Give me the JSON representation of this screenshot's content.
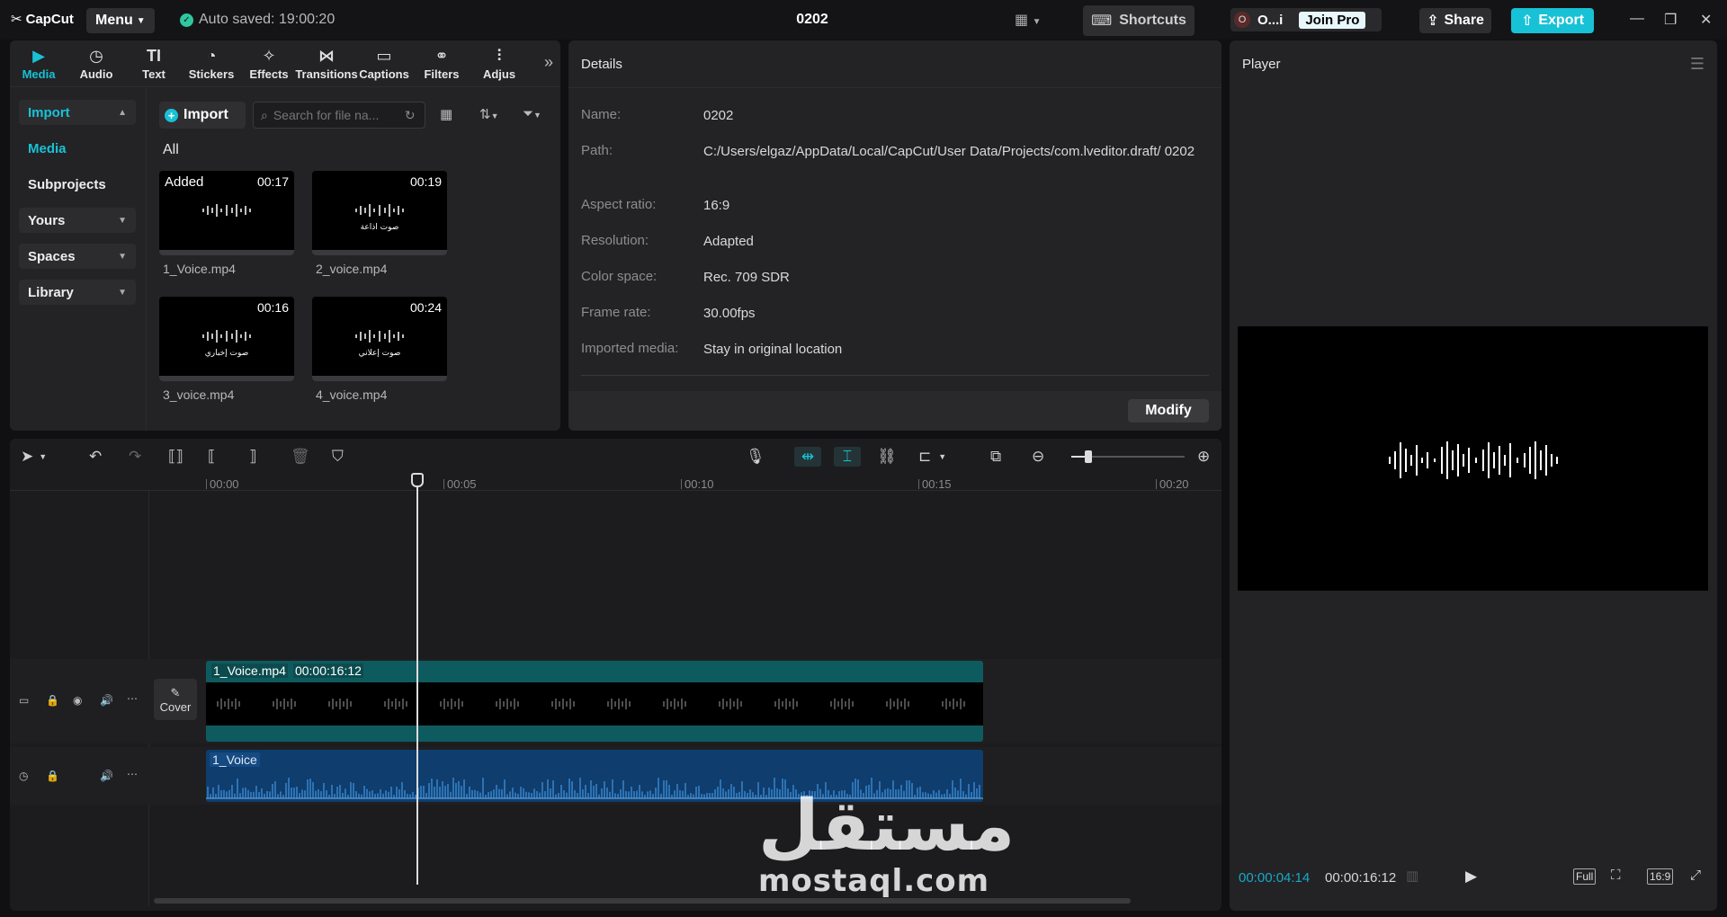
{
  "app": {
    "logo": "CapCut",
    "menu_label": "Menu",
    "autosave": "Auto saved: 19:00:20",
    "project_title": "0202",
    "shortcuts_label": "Shortcuts",
    "user_initial": "O",
    "user_name": "O...i",
    "join_pro": "Join Pro",
    "share_label": "Share",
    "export_label": "Export",
    "accent": "#18c2d6"
  },
  "media": {
    "tabs": [
      {
        "label": "Media",
        "icon": "media-icon"
      },
      {
        "label": "Audio",
        "icon": "audio-icon"
      },
      {
        "label": "Text",
        "icon": "text-icon"
      },
      {
        "label": "Stickers",
        "icon": "stickers-icon"
      },
      {
        "label": "Effects",
        "icon": "effects-icon"
      },
      {
        "label": "Transitions",
        "icon": "transitions-icon"
      },
      {
        "label": "Captions",
        "icon": "captions-icon"
      },
      {
        "label": "Filters",
        "icon": "filters-icon"
      },
      {
        "label": "Adjus",
        "icon": "adjust-icon"
      }
    ],
    "sidenav": {
      "import": "Import",
      "media": "Media",
      "subprojects": "Subprojects",
      "yours": "Yours",
      "spaces": "Spaces",
      "library": "Library"
    },
    "import_button": "Import",
    "search_placeholder": "Search for file na...",
    "filter_all": "All",
    "items": [
      {
        "name": "1_Voice.mp4",
        "duration": "00:17",
        "badge": "Added",
        "caption": ""
      },
      {
        "name": "2_voice.mp4",
        "duration": "00:19",
        "badge": "",
        "caption": "صوت اذاعة"
      },
      {
        "name": "3_voice.mp4",
        "duration": "00:16",
        "badge": "",
        "caption": "صوت إخباري"
      },
      {
        "name": "4_voice.mp4",
        "duration": "00:24",
        "badge": "",
        "caption": "صوت إعلاني"
      }
    ]
  },
  "details": {
    "title": "Details",
    "rows": [
      {
        "label": "Name:",
        "value": "0202"
      },
      {
        "label": "Path:",
        "value": "C:/Users/elgaz/AppData/Local/CapCut/User Data/Projects/com.lveditor.draft/ 0202"
      },
      {
        "label": "Aspect ratio:",
        "value": "16:9"
      },
      {
        "label": "Resolution:",
        "value": "Adapted"
      },
      {
        "label": "Color space:",
        "value": "Rec. 709 SDR"
      },
      {
        "label": "Frame rate:",
        "value": "30.00fps"
      },
      {
        "label": "Imported media:",
        "value": "Stay in original location"
      }
    ],
    "modify_label": "Modify"
  },
  "player": {
    "title": "Player",
    "current_time": "00:00:04:14",
    "total_time": "00:00:16:12",
    "full_label": "Full",
    "ratio_label": "16:9"
  },
  "timeline": {
    "ruler": [
      "00:00",
      "00:05",
      "00:10",
      "00:15",
      "00:20"
    ],
    "video_clip_name": "1_Voice.mp4",
    "video_clip_duration": "00:00:16:12",
    "audio_clip_name": "1_Voice",
    "cover_label": "Cover",
    "zoom_level": 0.15
  },
  "watermark": {
    "arabic": "مستقل",
    "latin": "mostaql.com"
  }
}
